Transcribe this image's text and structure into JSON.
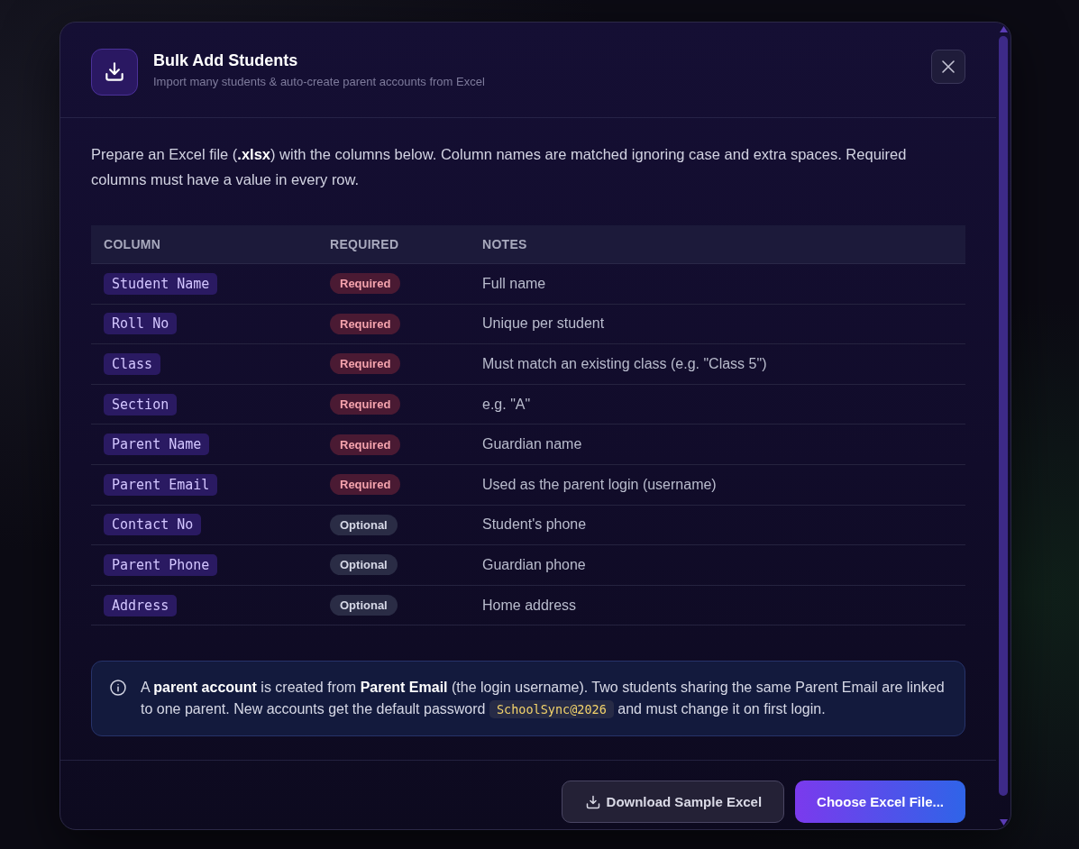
{
  "dialog": {
    "title": "Bulk Add Students",
    "subtitle": "Import many students & auto-create parent accounts from Excel"
  },
  "intro": "Prepare an Excel file (**.xlsx**) with the columns below. Column names are matched ignoring case and extra spaces. Required columns must have a value in every row.",
  "table": {
    "columns": [
      "COLUMN",
      "REQUIRED",
      "NOTES"
    ],
    "rows": [
      {
        "column": "Student Name",
        "badge": {
          "label": "Required",
          "kind": "required"
        },
        "notes": "Full name"
      },
      {
        "column": "Roll No",
        "badge": {
          "label": "Required",
          "kind": "required"
        },
        "notes": "Unique per student"
      },
      {
        "column": "Class",
        "badge": {
          "label": "Required",
          "kind": "required"
        },
        "notes": "Must match an existing class (e.g. \"Class 5\")"
      },
      {
        "column": "Section",
        "badge": {
          "label": "Required",
          "kind": "required"
        },
        "notes": "e.g. \"A\""
      },
      {
        "column": "Parent Name",
        "badge": {
          "label": "Required",
          "kind": "required"
        },
        "notes": "Guardian name"
      },
      {
        "column": "Parent Email",
        "badge": {
          "label": "Required",
          "kind": "required"
        },
        "notes": "Used as the parent login (username)"
      },
      {
        "column": "Contact No",
        "badge": {
          "label": "Optional",
          "kind": "optional"
        },
        "notes": "Student's phone"
      },
      {
        "column": "Parent Phone",
        "badge": {
          "label": "Optional",
          "kind": "optional"
        },
        "notes": "Guardian phone"
      },
      {
        "column": "Address",
        "badge": {
          "label": "Optional",
          "kind": "optional"
        },
        "notes": "Home address"
      }
    ]
  },
  "info": {
    "text_before": "A **parent account** is created from **Parent Email** (the login username). Two students sharing the same Parent Email are linked to one parent. New accounts get the default password",
    "password": "SchoolSync@2026",
    "text_after": "and must change it on first login."
  },
  "buttons": [
    {
      "label": "Download Sample Excel",
      "kind": "secondary"
    },
    {
      "label": "Choose Excel File...",
      "kind": "primary"
    }
  ]
}
